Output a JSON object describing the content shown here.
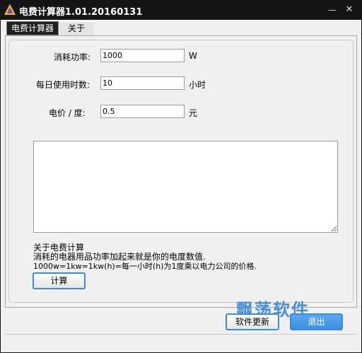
{
  "window": {
    "title": "电费计算器1.01.20160131",
    "minimize_glyph": "—",
    "close_glyph": "✕"
  },
  "tabs": [
    {
      "label": "电费计算器",
      "active": true
    },
    {
      "label": "关于",
      "active": false
    }
  ],
  "form": {
    "power_label": "消耗功率:",
    "power_value": "1000",
    "power_unit": "W",
    "hours_label": "每日使用时数:",
    "hours_value": "10",
    "hours_unit": "小时",
    "price_label": "电价 / 度:",
    "price_value": "0.5",
    "price_unit": "元"
  },
  "result_text": "",
  "about": {
    "heading": "关于电费计算",
    "line1": "消耗的电器用品功率加起来就是你的电度数值.",
    "line2": "1000w=1kw=1kw(h)=每一小时(h)为1度乘以电力公司的价格."
  },
  "buttons": {
    "calculate": "计算",
    "update": "软件更新",
    "exit": "退出"
  },
  "watermark": "飘荡软件",
  "colors": {
    "titlebar": "#151515",
    "accent": "#3c8be0",
    "watermark": "#4a8ed6"
  }
}
